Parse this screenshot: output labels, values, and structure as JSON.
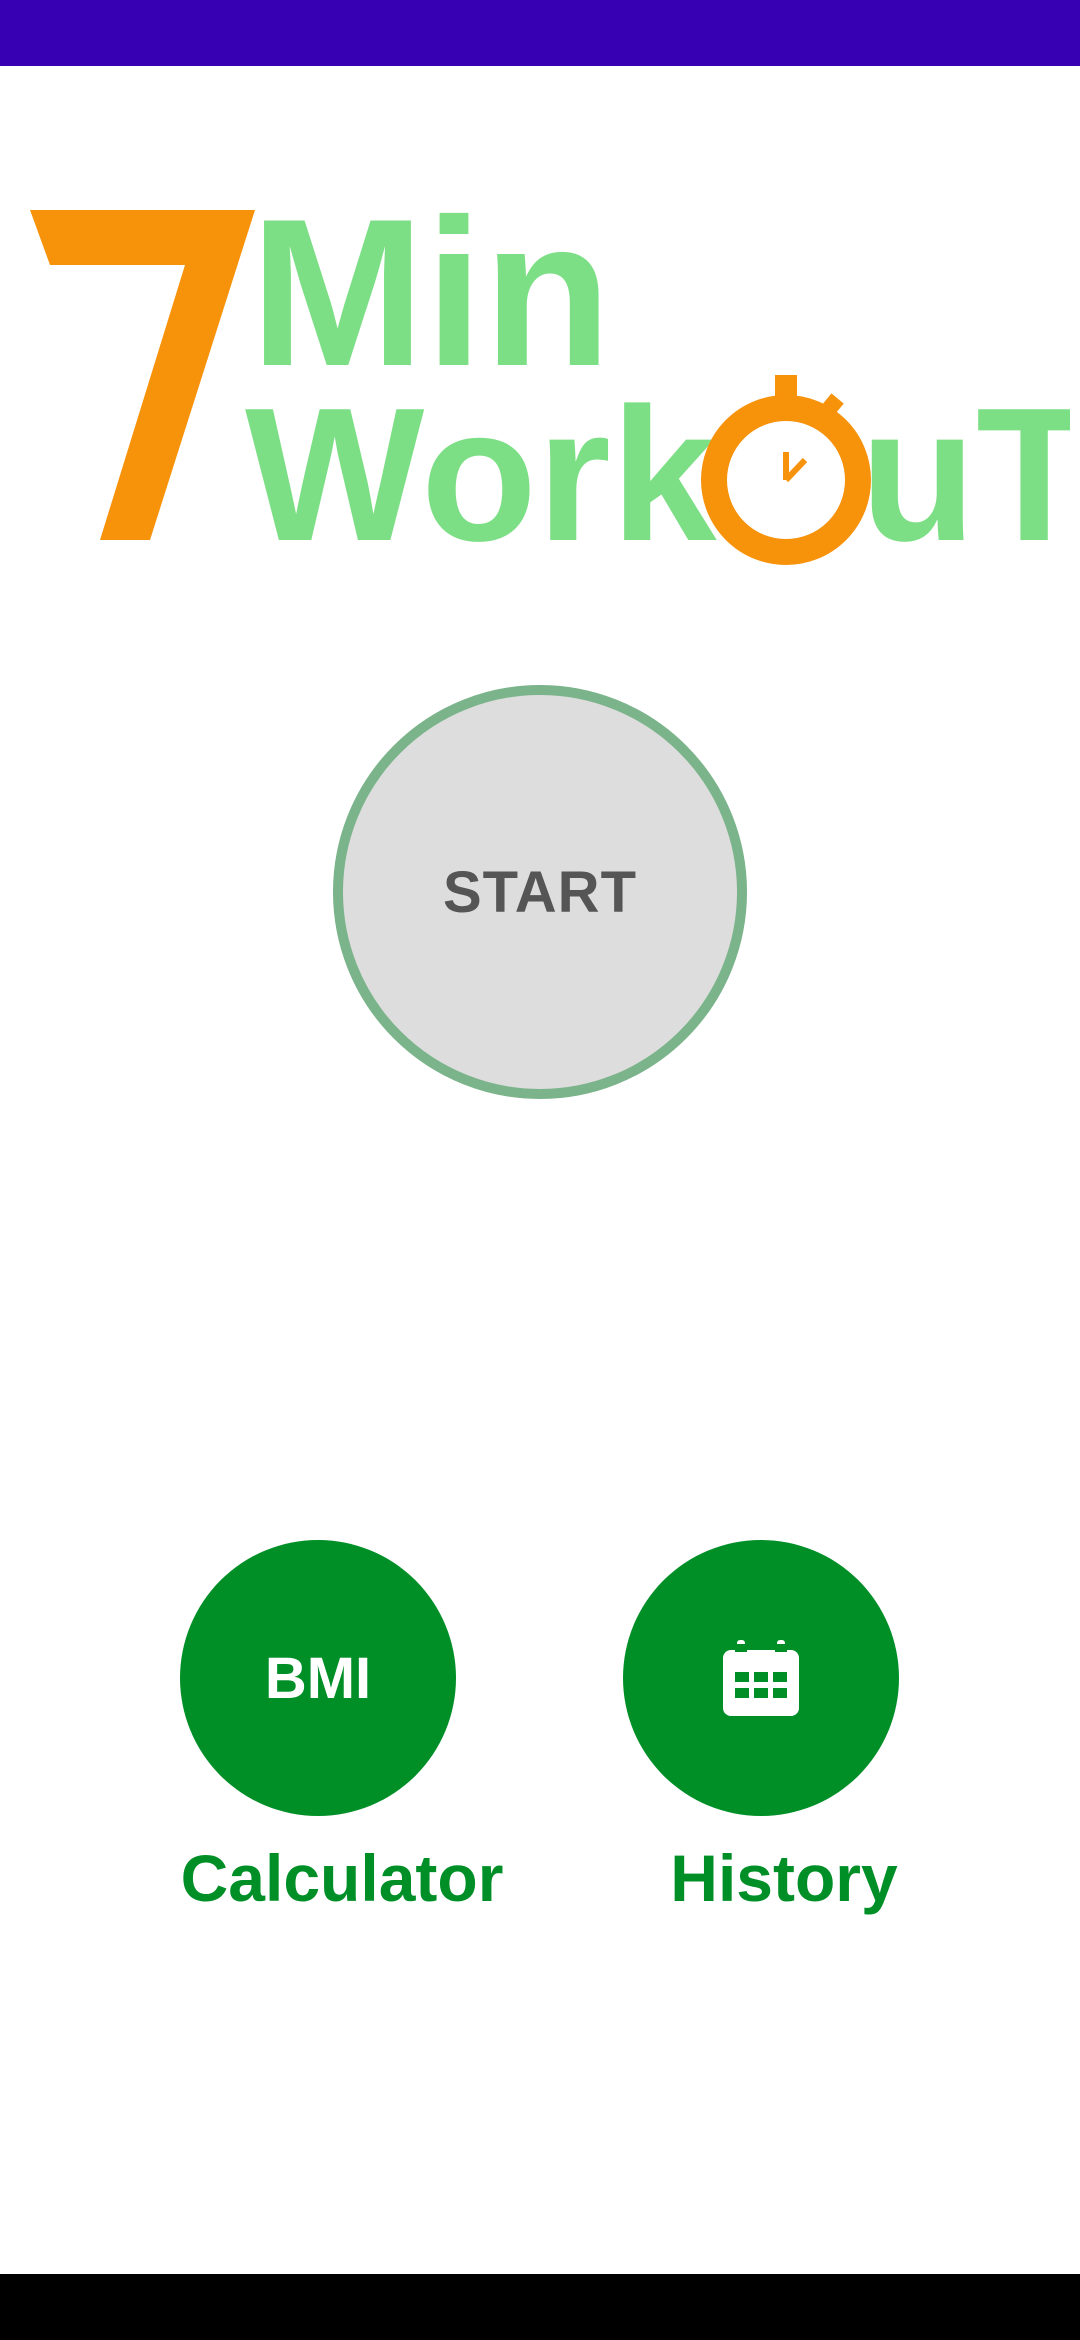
{
  "logo": {
    "number": "7",
    "word1": "Min",
    "word2_part1": "Work",
    "word2_part2": "uT",
    "colors": {
      "orange": "#f7920b",
      "green": "#7ddf85"
    }
  },
  "start": {
    "label": "START"
  },
  "bmi": {
    "label": "BMI",
    "caption": "Calculator"
  },
  "history": {
    "icon": "calendar-icon",
    "caption": "History"
  },
  "colors": {
    "status_bar": "#3700b3",
    "accent_green": "#008f27",
    "start_ring": "#7bb38a",
    "start_fill": "#dddddd"
  }
}
